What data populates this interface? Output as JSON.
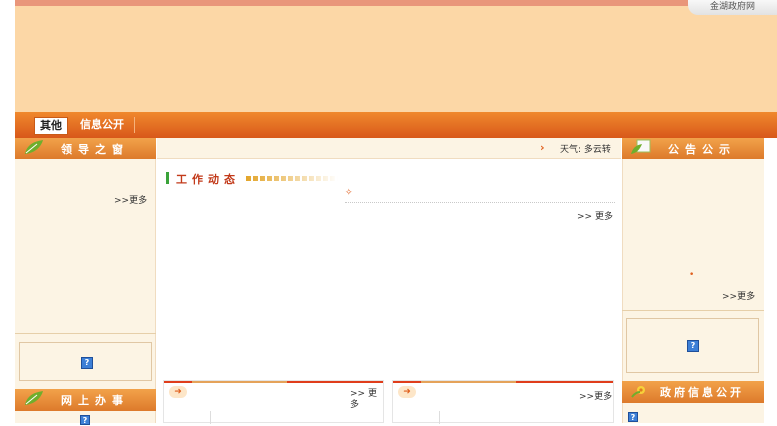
{
  "header": {
    "site_link": "金湖政府网"
  },
  "nav": {
    "tabs": [
      {
        "label": "其他"
      },
      {
        "label": "信息公开"
      }
    ]
  },
  "left": {
    "leaders": {
      "title": "领导之窗",
      "more": ">>更多"
    },
    "online": {
      "title": "网上办事"
    }
  },
  "center": {
    "weather": "天气: 多云转",
    "weather_arrow": "›",
    "work": {
      "title": "工作动态",
      "bullet": "✧",
      "more": ">> 更多"
    },
    "box1": {
      "more": ">> 更多"
    },
    "box2": {
      "more": ">>更多"
    }
  },
  "right": {
    "notice": {
      "title": "公告公示",
      "bullet": "•",
      "more": ">>更多"
    },
    "gov_info": {
      "title": "政府信息公开"
    }
  },
  "icons": {
    "help": "?",
    "arrow": "➜"
  },
  "colors": {
    "banner": "#fcd7a6",
    "nav": "#e06a22",
    "panel": "#fcf4e4",
    "accent_red": "#c23a1a"
  }
}
